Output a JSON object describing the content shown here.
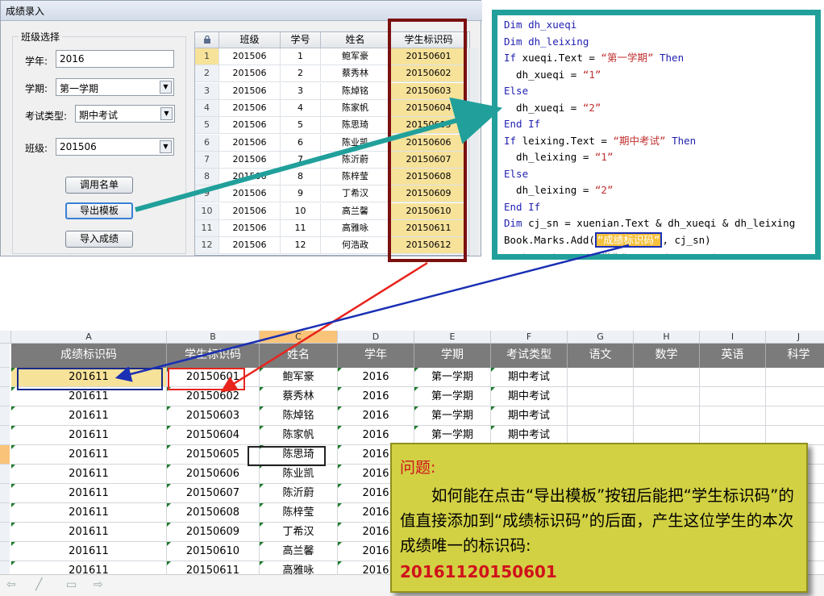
{
  "window": {
    "title": "成绩录入"
  },
  "form": {
    "group_title": "班级选择",
    "year_label": "学年:",
    "year_value": "2016",
    "term_label": "学期:",
    "term_value": "第一学期",
    "exam_label": "考试类型:",
    "exam_value": "期中考试",
    "class_label": "班级:",
    "class_value": "201506",
    "btn_roster": "调用名单",
    "btn_export": "导出模板",
    "btn_import": "导入成绩"
  },
  "grid": {
    "headers": [
      "班级",
      "学号",
      "姓名",
      "学生标识码"
    ],
    "rows": [
      [
        "1",
        "201506",
        "1",
        "鲍军豪",
        "20150601"
      ],
      [
        "2",
        "201506",
        "2",
        "蔡秀林",
        "20150602"
      ],
      [
        "3",
        "201506",
        "3",
        "陈焯铭",
        "20150603"
      ],
      [
        "4",
        "201506",
        "4",
        "陈家帆",
        "20150604"
      ],
      [
        "5",
        "201506",
        "5",
        "陈思琦",
        "20150605"
      ],
      [
        "6",
        "201506",
        "6",
        "陈业凯",
        "20150606"
      ],
      [
        "7",
        "201506",
        "7",
        "陈沂蔚",
        "20150607"
      ],
      [
        "8",
        "201506",
        "8",
        "陈梓莹",
        "20150608"
      ],
      [
        "9",
        "201506",
        "9",
        "丁希汉",
        "20150609"
      ],
      [
        "10",
        "201506",
        "10",
        "高兰馨",
        "20150610"
      ],
      [
        "11",
        "201506",
        "11",
        "高雅咏",
        "20150611"
      ],
      [
        "12",
        "201506",
        "12",
        "何浩政",
        "20150612"
      ]
    ]
  },
  "code": {
    "l1": "Dim dh_xueqi",
    "l2": "Dim dh_leixing",
    "l3a": "If",
    "l3b": " xueqi.Text = ",
    "l3c": "“第一学期”",
    "l3d": " Then",
    "l4a": "  dh_xueqi = ",
    "l4b": "“1”",
    "l5": "Else",
    "l6a": "  dh_xueqi = ",
    "l6b": "“2”",
    "l7": "End If",
    "l8a": "If",
    "l8b": " leixing.Text = ",
    "l8c": "“期中考试”",
    "l8d": " Then",
    "l9a": "  dh_leixing = ",
    "l9b": "“1”",
    "l10": "Else",
    "l11a": "  dh_leixing = ",
    "l11b": "“2”",
    "l12": "End If",
    "l13a": "Dim",
    "l13b": " cj_sn = xuenian.Text & dh_xueqi & dh_leixing",
    "l14a": "Book.Marks.Add(",
    "l14b": "“成绩标识码”",
    "l14c": ", cj_sn)"
  },
  "sheet": {
    "col_letters": [
      "A",
      "B",
      "C",
      "D",
      "E",
      "F",
      "G",
      "H",
      "I",
      "J"
    ],
    "headers": [
      "成绩标识码",
      "学生标识码",
      "姓名",
      "学年",
      "学期",
      "考试类型",
      "语文",
      "数学",
      "英语",
      "科学"
    ],
    "rows": [
      [
        "201611",
        "20150601",
        "鲍军豪",
        "2016",
        "第一学期",
        "期中考试"
      ],
      [
        "201611",
        "20150602",
        "蔡秀林",
        "2016",
        "第一学期",
        "期中考试"
      ],
      [
        "201611",
        "20150603",
        "陈焯铭",
        "2016",
        "第一学期",
        "期中考试"
      ],
      [
        "201611",
        "20150604",
        "陈家帆",
        "2016",
        "第一学期",
        "期中考试"
      ],
      [
        "201611",
        "20150605",
        "陈思琦",
        "2016",
        "",
        ""
      ],
      [
        "201611",
        "20150606",
        "陈业凯",
        "2016",
        "",
        ""
      ],
      [
        "201611",
        "20150607",
        "陈沂蔚",
        "2016",
        "",
        ""
      ],
      [
        "201611",
        "20150608",
        "陈梓莹",
        "2016",
        "",
        ""
      ],
      [
        "201611",
        "20150609",
        "丁希汉",
        "2016",
        "",
        ""
      ],
      [
        "201611",
        "20150610",
        "高兰馨",
        "2016",
        "",
        ""
      ],
      [
        "201611",
        "20150611",
        "高雅咏",
        "2016",
        "",
        ""
      ]
    ]
  },
  "question": {
    "title": "问题:",
    "body": "如何能在点击“导出模板”按钮后能把“学生标识码”的值直接添加到“成绩标识码”的后面，产生这位学生的本次成绩唯一的标识码:",
    "answer": "20161120150601"
  },
  "colors": {
    "teal": "#21a09b",
    "dark_red": "#7a1010",
    "navy": "#1a2fb4",
    "red": "#e8241c",
    "yellow_cell": "#f7e29a",
    "question_bg": "#d2d144"
  }
}
